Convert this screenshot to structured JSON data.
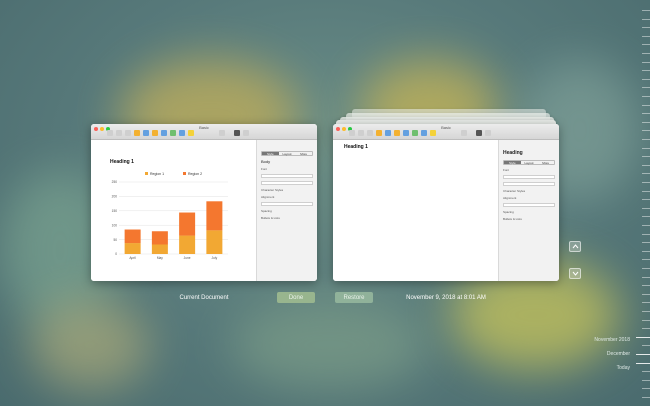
{
  "left_window": {
    "title": "Basic",
    "doc_heading": "Heading 1",
    "inspector": {
      "tabs": [
        "Style",
        "Layout",
        "More"
      ],
      "style_name": "Body",
      "labels": [
        "Font",
        "Character Styles",
        "Alignment",
        "Spacing",
        "Bullets & Lists"
      ]
    }
  },
  "right_window": {
    "title": "Basic",
    "doc_heading": "Heading 1",
    "inspector": {
      "tabs": [
        "Style",
        "Layout",
        "More"
      ],
      "style_name": "Heading",
      "labels": [
        "Font",
        "Character Styles",
        "Alignment",
        "Spacing",
        "Bullets & Lists"
      ]
    }
  },
  "captions": {
    "current": "Current Document",
    "timestamp": "November 9, 2018 at 8:01 AM"
  },
  "buttons": {
    "done": "Done",
    "restore": "Restore"
  },
  "timeline": {
    "labels": [
      "November 2018",
      "December",
      "Today"
    ]
  },
  "colors": {
    "region1": "#f2a833",
    "region2": "#f4772f"
  },
  "chart_data": {
    "type": "bar",
    "stacked": true,
    "categories": [
      "April",
      "May",
      "June",
      "July"
    ],
    "series": [
      {
        "name": "Region 1",
        "values": [
          38,
          33,
          64,
          82
        ]
      },
      {
        "name": "Region 2",
        "values": [
          47,
          46,
          80,
          101
        ]
      }
    ],
    "ylim": [
      0,
      250
    ],
    "yticks": [
      0,
      50,
      100,
      150,
      200,
      250
    ],
    "legend": "top"
  }
}
